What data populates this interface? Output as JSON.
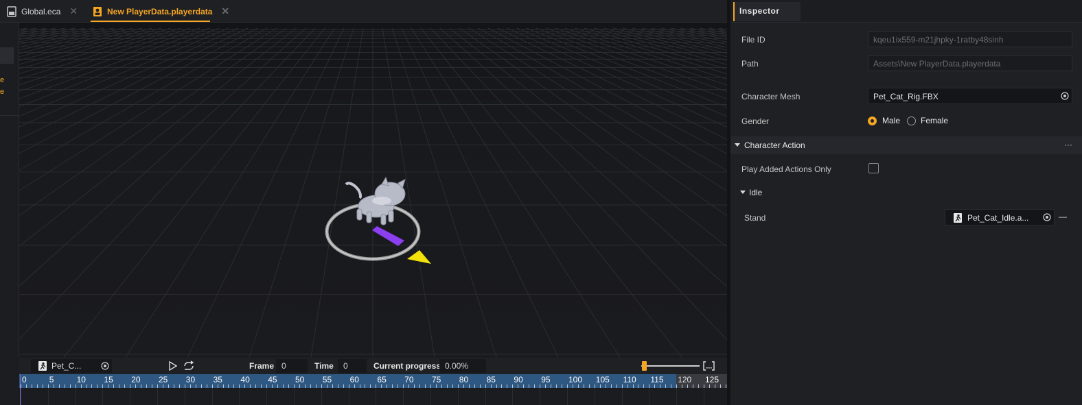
{
  "tabs": [
    {
      "label": "Global.eca",
      "active": false
    },
    {
      "label": "New PlayerData.playerdata",
      "active": true
    }
  ],
  "left_panel": {
    "line1": "e",
    "line2": "e"
  },
  "anim_toolbar": {
    "clip_name": "Pet_C...",
    "frame_label": "Frame",
    "frame_value": "0",
    "time_label": "Time",
    "time_value": "0",
    "progress_label": "Current progress",
    "progress_value": "0.00%",
    "zoom_level": 0.05
  },
  "timeline": {
    "ticks": [
      "0",
      "5",
      "10",
      "15",
      "20",
      "25",
      "30",
      "35",
      "40",
      "45",
      "50",
      "55",
      "60",
      "65",
      "70",
      "75",
      "80",
      "85",
      "90",
      "95",
      "100",
      "105",
      "110",
      "115",
      "120",
      "125"
    ],
    "highlighted_range_end": "120"
  },
  "inspector": {
    "title": "Inspector",
    "file_id_label": "File ID",
    "file_id_value": "kqeu1ix559-m21jhpky-1ratby48sinh",
    "path_label": "Path",
    "path_value": "Assets\\New PlayerData.playerdata",
    "mesh_label": "Character Mesh",
    "mesh_value": "Pet_Cat_Rig.FBX",
    "gender_label": "Gender",
    "gender_options": [
      "Male",
      "Female"
    ],
    "gender_selected": "Male",
    "section_title": "Character Action",
    "section_more": "···",
    "play_added_label": "Play Added Actions Only",
    "play_added_checked": false,
    "idle_label": "Idle",
    "stand_label": "Stand",
    "stand_value": "Pet_Cat_Idle.a...",
    "remove_symbol": "—"
  },
  "colors": {
    "accent": "#f5a623",
    "ruler": "#2e5781",
    "marker_purple": "#8b3ff0",
    "marker_yellow": "#f2e20a"
  }
}
